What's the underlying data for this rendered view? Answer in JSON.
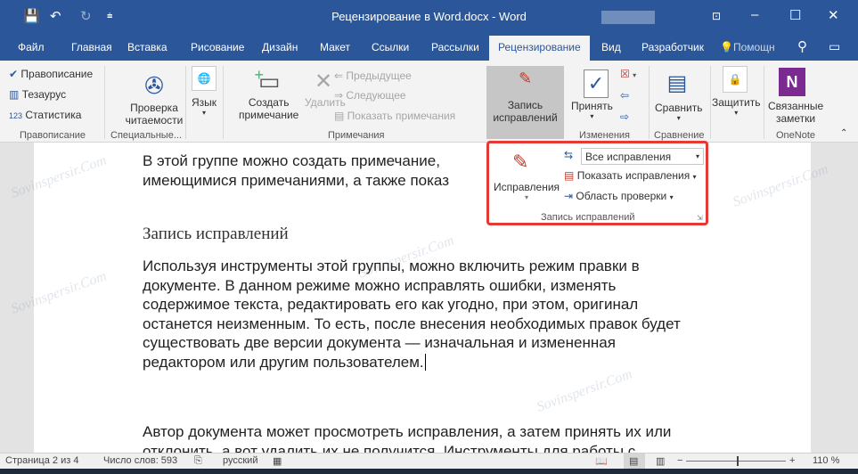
{
  "title_bar": {
    "title": "Рецензирование в Word.docx  -  Word",
    "save": "💾",
    "undo": "↶",
    "redo": "↻",
    "customize": "⩧"
  },
  "tabs": [
    "Файл",
    "Главная",
    "Вставка",
    "Рисование",
    "Дизайн",
    "Макет",
    "Ссылки",
    "Рассылки",
    "Рецензирование",
    "Вид",
    "Разработчик"
  ],
  "tell_me": "Помощн",
  "ribbon": {
    "spelling": {
      "items": [
        "Правописание",
        "Тезаурус",
        "Статистика"
      ],
      "group": "Правописание"
    },
    "accessibility": {
      "label1": "Проверка",
      "label2": "читаемости",
      "group": "Специальные..."
    },
    "language": {
      "label": "Язык"
    },
    "comments": {
      "new1": "Создать",
      "new2": "примечание",
      "delete": "Удалить",
      "prev": "Предыдущее",
      "next": "Следующее",
      "show": "Показать примечания",
      "group": "Примечания"
    },
    "tracking": {
      "label1": "Запись",
      "label2": "исправлений"
    },
    "changes": {
      "accept": "Принять",
      "group": "Изменения"
    },
    "compare": {
      "label": "Сравнить",
      "group": "Сравнение"
    },
    "protect": {
      "label": "Защитить"
    },
    "onenote": {
      "label1": "Связанные",
      "label2": "заметки",
      "group": "OneNote"
    }
  },
  "popup": {
    "track": "Исправления",
    "markup_select": "Все исправления",
    "show_markup": "Показать исправления",
    "reviewing_pane": "Область проверки",
    "group": "Запись исправлений"
  },
  "document": {
    "p1": [
      "В этой группе можно создать примечание,",
      "имеющимися примечаниями, а также показ"
    ],
    "heading": "Запись исправлений",
    "p2": [
      "Используя инструменты этой группы, можно включить режим правки в",
      "документе. В данном режиме можно исправлять ошибки, изменять",
      "содержимое текста, редактировать его как угодно, при этом, оригинал",
      "останется неизменным. То есть, после внесения необходимых правок будет",
      "существовать две версии документа — изначальная и измененная",
      "редактором или другим пользователем."
    ],
    "p3": [
      "Автор документа может просмотреть исправления, а затем принять их или",
      "отклонить, а вот удалить их не получится. Инструменты для работы с"
    ]
  },
  "status": {
    "page": "Страница 2 из 4",
    "words": "Число слов: 593",
    "lang": "русский",
    "zoom": "110 %",
    "zoom_percent": 110
  }
}
